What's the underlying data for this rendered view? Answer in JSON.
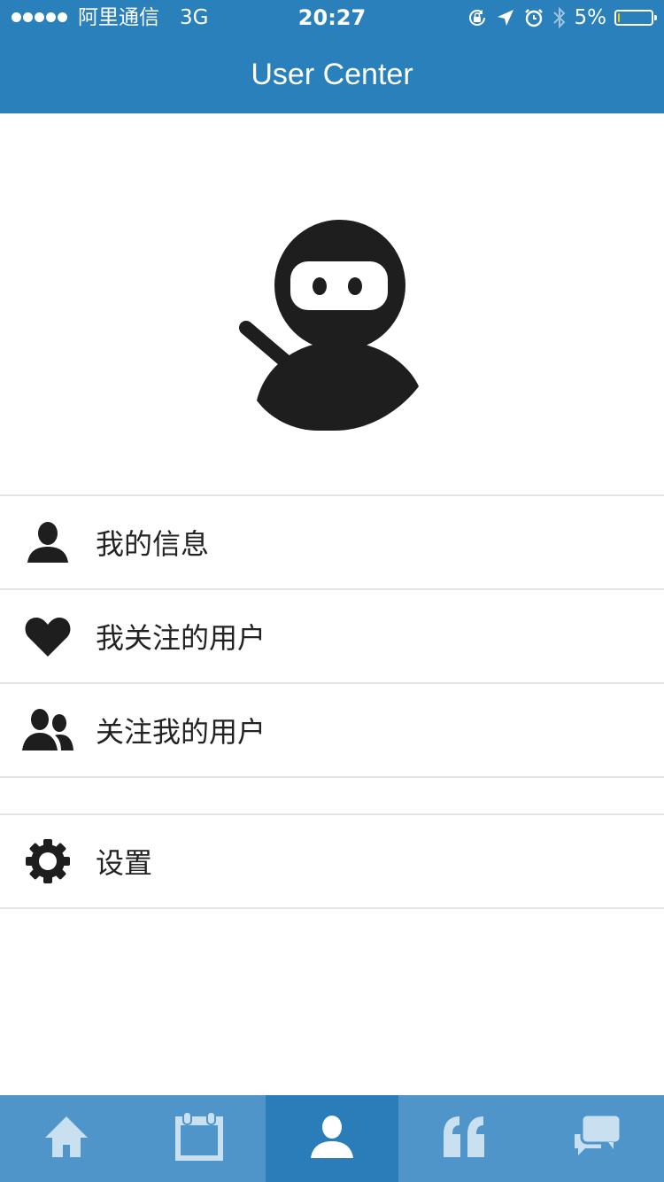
{
  "status_bar": {
    "carrier": "阿里通信",
    "network": "3G",
    "time": "20:27",
    "battery_percent": "5%",
    "battery_level": 0.05,
    "icons": [
      "rotation-lock-icon",
      "location-arrow-icon",
      "alarm-icon",
      "bluetooth-icon",
      "battery-icon"
    ]
  },
  "header": {
    "title": "User Center"
  },
  "profile": {
    "avatar_icon": "ninja-avatar-icon"
  },
  "menu": {
    "items": [
      {
        "label": "我的信息",
        "icon": "user-icon"
      },
      {
        "label": "我关注的用户",
        "icon": "heart-icon"
      },
      {
        "label": "关注我的用户",
        "icon": "users-icon"
      }
    ],
    "settings": {
      "label": "设置",
      "icon": "gear-icon"
    }
  },
  "tab_bar": {
    "tabs": [
      {
        "icon": "home-icon",
        "active": false
      },
      {
        "icon": "calendar-icon",
        "active": false
      },
      {
        "icon": "user-icon",
        "active": true
      },
      {
        "icon": "quote-icon",
        "active": false
      },
      {
        "icon": "chat-icon",
        "active": false
      }
    ]
  },
  "colors": {
    "primary": "#2a80ba",
    "tab_bar": "#4f95c9",
    "tab_active": "#2a7db8",
    "tab_icon_inactive": "#c9e0f1",
    "battery_fill": "#f5d000"
  }
}
